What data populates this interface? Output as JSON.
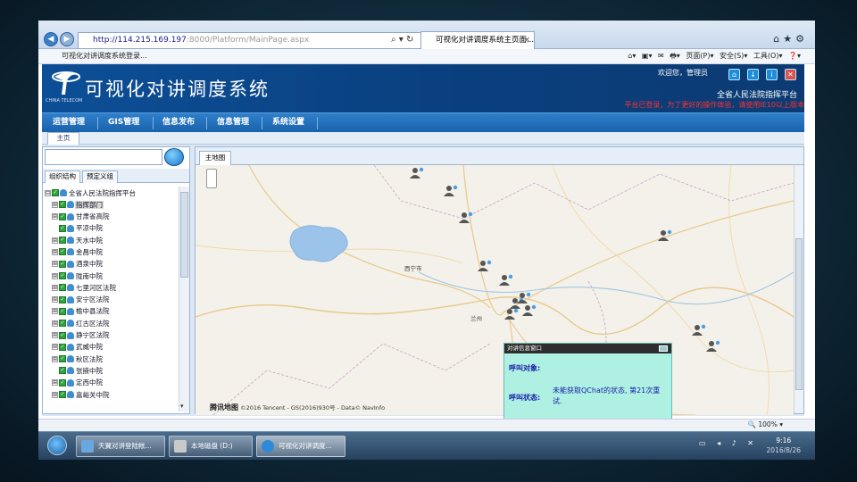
{
  "browser": {
    "address": "http://114.215.169.197:8000/Platform/MainPage.aspx",
    "address_host": "http://114.215.169.197",
    "address_rest": ":8000/Platform/MainPage.aspx",
    "tab_title": "可视化对讲调度系统主页面...",
    "fav_title": "可视化对讲调度系统登录...",
    "toolbar": [
      "页面(P)",
      "安全(S)",
      "工具(O)"
    ]
  },
  "app": {
    "logo_caption": "CHINA TELECOM",
    "title": "可视化对讲调度系统",
    "welcome": "欢迎您，管理员",
    "org_name": "全省人民法院指挥平台",
    "marquee": "平台已登录，为了更好的操作体验，请使用IE10以上版本"
  },
  "menu": [
    "运营管理",
    "GIS管理",
    "信息发布",
    "信息管理",
    "系统设置"
  ],
  "subtab": "主页",
  "left": {
    "tabs": [
      "组织结构",
      "预定义组"
    ],
    "tree": [
      {
        "label": "全省人民法院指挥平台",
        "level": 0,
        "expander": "⊟",
        "hl": false
      },
      {
        "label": "指挥部门",
        "level": 1,
        "expander": "⊞",
        "hl": true
      },
      {
        "label": "甘肃省高院",
        "level": 1,
        "expander": "⊞",
        "hl": false
      },
      {
        "label": "平凉中院",
        "level": 1,
        "expander": "",
        "hl": false
      },
      {
        "label": "天水中院",
        "level": 1,
        "expander": "⊞",
        "hl": false
      },
      {
        "label": "金昌中院",
        "level": 1,
        "expander": "⊞",
        "hl": false
      },
      {
        "label": "酒泉中院",
        "level": 1,
        "expander": "⊞",
        "hl": false
      },
      {
        "label": "陇南中院",
        "level": 1,
        "expander": "⊞",
        "hl": false
      },
      {
        "label": "七里河区法院",
        "level": 1,
        "expander": "⊞",
        "hl": false
      },
      {
        "label": "安宁区法院",
        "level": 1,
        "expander": "⊞",
        "hl": false
      },
      {
        "label": "榆中县法院",
        "level": 1,
        "expander": "⊞",
        "hl": false
      },
      {
        "label": "红古区法院",
        "level": 1,
        "expander": "⊞",
        "hl": false
      },
      {
        "label": "静宁区法院",
        "level": 1,
        "expander": "⊞",
        "hl": false
      },
      {
        "label": "武威中院",
        "level": 1,
        "expander": "⊞",
        "hl": false
      },
      {
        "label": "秋区法院",
        "level": 1,
        "expander": "⊞",
        "hl": false
      },
      {
        "label": "张掖中院",
        "level": 1,
        "expander": "",
        "hl": false
      },
      {
        "label": "定西中院",
        "level": 1,
        "expander": "⊞",
        "hl": false
      },
      {
        "label": "嘉峪关中院",
        "level": 1,
        "expander": "⊞",
        "hl": false
      }
    ]
  },
  "map": {
    "tab": "主地图",
    "city_label": "西宁市",
    "city2_label": "兰州",
    "brand": "腾讯地图",
    "copyright": "©2016 Tencent - GS(2016)930号 - Data© NavInfo",
    "zoom": "100%"
  },
  "popup": {
    "title": "对讲信息窗口",
    "caller_label": "呼叫对象:",
    "status_label": "呼叫状态:",
    "status_text": "未能获取QChat的状态, 第21次重试.",
    "hangup": "挂断"
  },
  "taskbar": {
    "tasks": [
      "天翼对讲登陆帐...",
      "本地磁盘 (D:)",
      "可视化对讲调度..."
    ],
    "time": "9:16",
    "date": "2016/8/26"
  }
}
